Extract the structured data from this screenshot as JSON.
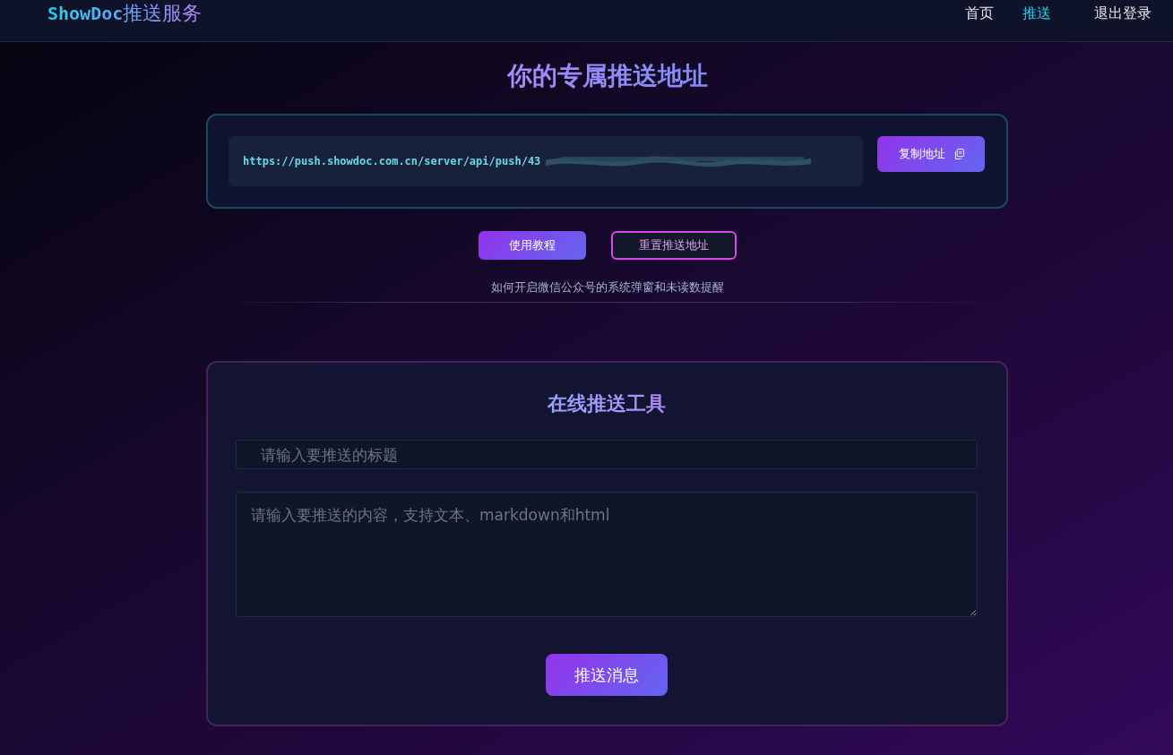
{
  "header": {
    "logo": {
      "brand": "ShowDoc",
      "suffix": "推送服务"
    },
    "nav": [
      {
        "label": "首页",
        "selected": false
      },
      {
        "label": "推送",
        "selected": true
      },
      {
        "label": "退出登录",
        "selected": false
      }
    ]
  },
  "push_address": {
    "title": "你的专属推送地址",
    "url": "https://push.showdoc.com.cn/server/api/push/43",
    "redacted": true,
    "copy_button": "复制地址"
  },
  "actions": [
    {
      "label": "使用教程",
      "kind": "primary"
    },
    {
      "label": "重置推送地址",
      "kind": "outline"
    }
  ],
  "help_link": "如何开启微信公众号的系统弹窗和未读数提醒",
  "push_tool": {
    "title": "在线推送工具",
    "title_field": {
      "placeholder": "请输入要推送的标题"
    },
    "content_field": {
      "placeholder": "请输入要推送的内容，支持文本、markdown和html"
    },
    "submit_button": "推送消息"
  }
}
